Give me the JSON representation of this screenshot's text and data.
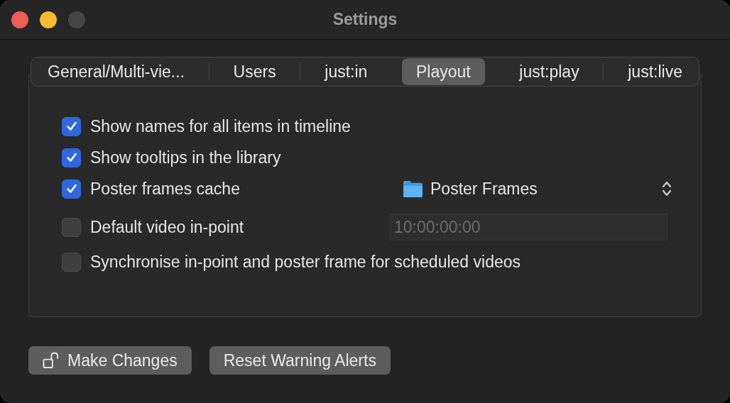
{
  "window": {
    "title": "Settings"
  },
  "tabs": [
    {
      "label": "General/Multi-vie...",
      "selected": false
    },
    {
      "label": "Users",
      "selected": false
    },
    {
      "label": "just:in",
      "selected": false
    },
    {
      "label": "Playout",
      "selected": true
    },
    {
      "label": "just:play",
      "selected": false
    },
    {
      "label": "just:live",
      "selected": false
    }
  ],
  "options": [
    {
      "label": "Show names for all items in timeline",
      "checked": true
    },
    {
      "label": "Show tooltips in the library",
      "checked": true
    },
    {
      "label": "Poster frames cache",
      "checked": true,
      "control": {
        "kind": "popup",
        "value": "Poster Frames"
      }
    },
    {
      "label": "Default video in-point",
      "checked": false,
      "control": {
        "kind": "field",
        "value": "10:00:00:00",
        "disabled": true
      }
    },
    {
      "label": "Synchronise in-point and poster frame for scheduled videos",
      "checked": false
    }
  ],
  "buttons": [
    {
      "label": "Make Changes",
      "kind": "lock"
    },
    {
      "label": "Reset Warning Alerts",
      "kind": "plain"
    }
  ]
}
